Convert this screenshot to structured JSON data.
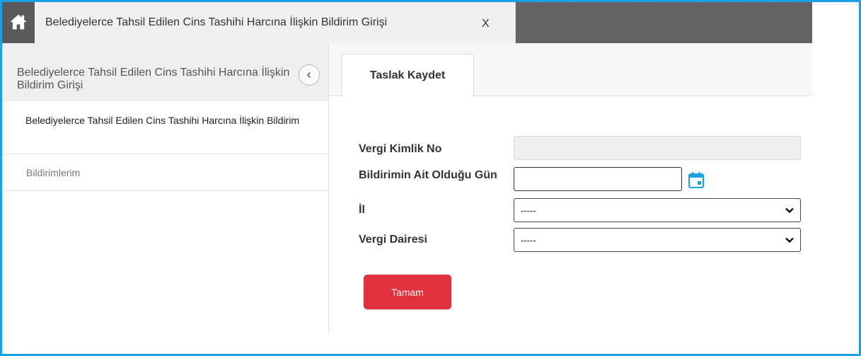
{
  "window": {
    "tab_title": "Belediyelerce Tahsil Edilen Cins Tashihi Harcına İlişkin Bildirim Girişi",
    "close_label": "X"
  },
  "sidebar": {
    "header_title": "Belediyelerce Tahsil Edilen Cins Tashihi Harcına İlişkin Bildirim Girişi",
    "items": [
      {
        "label": "Belediyelerce Tahsil Edilen Cins Tashihi Harcına İlişkin Bildirim",
        "active": true
      },
      {
        "label": "Bildirimlerim",
        "active": false
      }
    ]
  },
  "main": {
    "tabs": [
      {
        "label": "Taslak Kaydet",
        "active": true
      }
    ],
    "form": {
      "vkn_label": "Vergi Kimlik No",
      "vkn_value": "",
      "date_label": "Bildirimin Ait Olduğu Gün",
      "date_value": "",
      "il_label": "İl",
      "il_selected": "-----",
      "vd_label": "Vergi Dairesi",
      "vd_selected": "-----",
      "submit_label": "Tamam"
    }
  },
  "colors": {
    "frame_border": "#1ba1e2",
    "primary_button": "#e0323e",
    "calendar_icon": "#1ba1e2"
  },
  "icons": [
    "home-icon",
    "collapse-icon",
    "calendar-icon",
    "chevron-down-icon"
  ]
}
